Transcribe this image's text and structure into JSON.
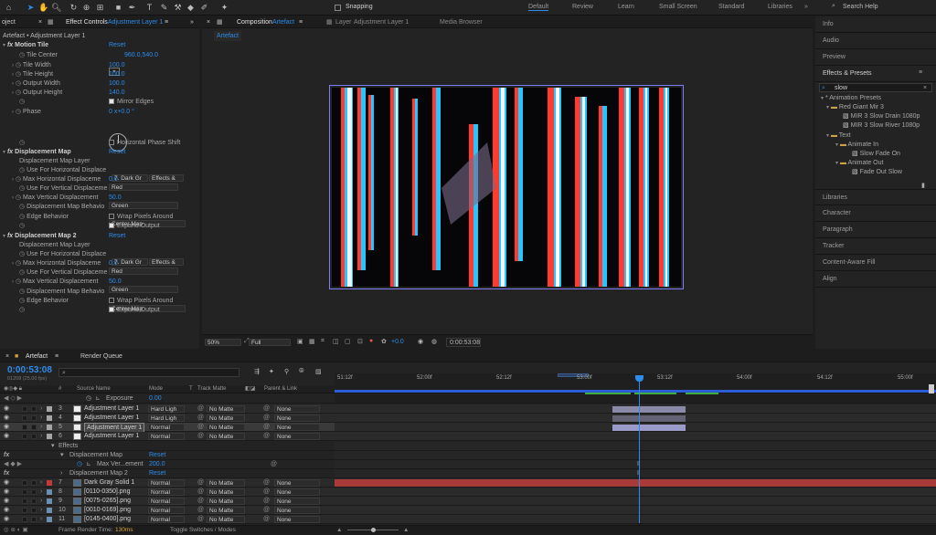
{
  "toolbar": {
    "snapping": "Snapping",
    "workspaces": [
      "Default",
      "Review",
      "Learn",
      "Small Screen",
      "Standard",
      "Libraries"
    ],
    "active_workspace": "Default",
    "search": "Search Help"
  },
  "effect_controls": {
    "tab_project": "oject",
    "tab_label": "Effect Controls",
    "layer": "Adjustment Layer 1",
    "breadcrumb": "Artefact • Adjustment Layer 1",
    "motion_tile": {
      "name": "Motion Tile",
      "reset": "Reset",
      "tile_center_label": "Tile Center",
      "tile_center_value": "960.0,540.0",
      "tile_width_label": "Tile Width",
      "tile_width": "100.0",
      "tile_height_label": "Tile Height",
      "tile_height": "100.0",
      "output_width_label": "Output Width",
      "output_width": "100.0",
      "output_height_label": "Output Height",
      "output_height": "140.0",
      "mirror_edges": "Mirror Edges",
      "phase_label": "Phase",
      "phase_value": "0 x+0.0 °",
      "horizontal_phase_shift": "Horizontal Phase Shift"
    },
    "displacement_map": {
      "name": "Displacement Map",
      "reset": "Reset",
      "layer_label": "Displacement Map Layer",
      "layer_value": "7. Dark Gr",
      "layer_src": "Effects &",
      "use_h_label": "Use For Horizontal Displace",
      "use_h": "Red",
      "max_h_label": "Max Horizontal Displaceme",
      "max_h": "0.0",
      "use_v_label": "Use For Vertical Displaceme",
      "use_v": "Green",
      "max_v_label": "Max Vertical Displacement",
      "max_v": "50.0",
      "behavior_label": "Displacement Map Behavio",
      "behavior": "Center Map",
      "edge_label": "Edge Behavior",
      "wrap": "Wrap Pixels Around",
      "expand": "Expand Output"
    },
    "displacement_map2": {
      "name": "Displacement Map 2",
      "reset": "Reset",
      "layer_label": "Displacement Map Layer",
      "layer_value": "7. Dark Gr",
      "layer_src": "Effects &",
      "use_h_label": "Use For Horizontal Displace",
      "use_h": "Red",
      "max_h_label": "Max Horizontal Displaceme",
      "max_h": "0.0",
      "use_v_label": "Use For Vertical Displaceme",
      "use_v": "Green",
      "max_v_label": "Max Vertical Displacement",
      "max_v": "50.0",
      "behavior_label": "Displacement Map Behavio",
      "behavior": "Center Map",
      "edge_label": "Edge Behavior",
      "wrap": "Wrap Pixels Around",
      "expand": "Expand Output"
    }
  },
  "composition": {
    "tab_label": "Composition",
    "comp_name": "Artefact",
    "layer_tab": "Layer",
    "layer_tab_value": "Adjustment Layer 1",
    "media_browser": "Media Browser",
    "subtab": "Artefact",
    "zoom": "50%",
    "quality": "Full",
    "exposure": "+0.0",
    "timecode": "0:00:53:08"
  },
  "right_panel": {
    "info": "Info",
    "audio": "Audio",
    "preview": "Preview",
    "effects_presets": "Effects & Presets",
    "search": "slow",
    "tree": [
      "* Animation Presets",
      "Red Giant Mir 3",
      "MIR 3 Slow Drain 1080p",
      "MIR 3 Slow River 1080p",
      "Text",
      "Animate In",
      "Slow Fade On",
      "Animate Out",
      "Fade Out Slow"
    ],
    "panels": [
      "Libraries",
      "Character",
      "Paragraph",
      "Tracker",
      "Content-Aware Fill",
      "Align"
    ]
  },
  "timeline": {
    "tab": "Artefact",
    "render_queue": "Render Queue",
    "timecode": "0:00:53:08",
    "fps": "01208 (25.00 fps)",
    "col_source": "Source Name",
    "col_mode": "Mode",
    "col_t": "T",
    "col_trkmat": "Track Matte",
    "col_parent": "Parent & Link",
    "col_num": "#",
    "ruler": [
      "51:12f",
      "52:00f",
      "52:12f",
      "53:00f",
      "53:12f",
      "54:00f",
      "54:12f",
      "55:00f"
    ],
    "exposure_label": "Exposure",
    "exposure_value": "0.00",
    "layers": [
      {
        "num": "3",
        "name": "Adjustment Layer 1",
        "mode": "Hard Ligh",
        "matte": "No Matte",
        "parent": "None",
        "color": "#a5a5a5"
      },
      {
        "num": "4",
        "name": "Adjustment Layer 1",
        "mode": "Hard Ligh",
        "matte": "No Matte",
        "parent": "None",
        "color": "#a5a5a5"
      },
      {
        "num": "5",
        "name": "Adjustment Layer 1",
        "mode": "Normal",
        "matte": "No Matte",
        "parent": "None",
        "color": "#a5a5a5"
      },
      {
        "num": "6",
        "name": "Adjustment Layer 1",
        "mode": "Normal",
        "matte": "No Matte",
        "parent": "None",
        "color": "#a5a5a5"
      }
    ],
    "effects_label": "Effects",
    "disp_label": "Displacement Map",
    "disp_reset": "Reset",
    "maxvert_label": "Max Ver...ement",
    "maxvert_value": "200.0",
    "disp2_label": "Displacement Map 2",
    "disp2_reset": "Reset",
    "layers2": [
      {
        "num": "7",
        "name": "Dark Gray Solid 1",
        "mode": "Normal",
        "matte": "No Matte",
        "parent": "None",
        "color": "#c43a3a"
      },
      {
        "num": "8",
        "name": "[0110-0350].png",
        "mode": "Normal",
        "matte": "No Matte",
        "parent": "None",
        "color": "#6a8fb0"
      },
      {
        "num": "9",
        "name": "[0075-0265].png",
        "mode": "Normal",
        "matte": "No Matte",
        "parent": "None",
        "color": "#6a8fb0"
      },
      {
        "num": "10",
        "name": "[0010-0169].png",
        "mode": "Normal",
        "matte": "No Matte",
        "parent": "None",
        "color": "#6a8fb0"
      },
      {
        "num": "11",
        "name": "[0145-0400].png",
        "mode": "Normal",
        "matte": "No Matte",
        "parent": "None",
        "color": "#6a8fb0"
      }
    ],
    "frame_render_label": "Frame Render Time:",
    "frame_render_value": "130ms",
    "toggle": "Toggle Switches / Modes"
  }
}
